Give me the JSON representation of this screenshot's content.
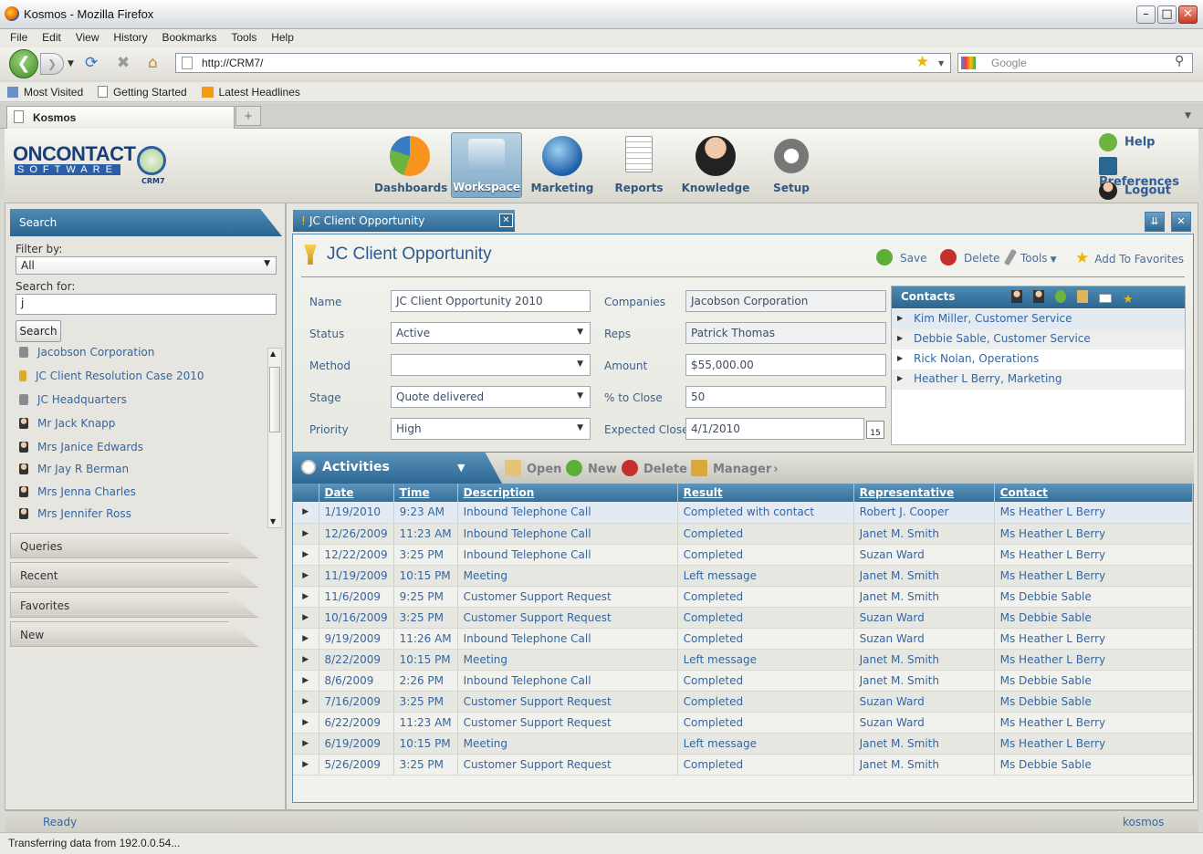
{
  "window": {
    "title": "Kosmos - Mozilla Firefox"
  },
  "menu": [
    "File",
    "Edit",
    "View",
    "History",
    "Bookmarks",
    "Tools",
    "Help"
  ],
  "nav": {
    "url": "http://CRM7/",
    "search_placeholder": "Google"
  },
  "bookmarks": [
    "Most Visited",
    "Getting Started",
    "Latest Headlines"
  ],
  "browser_tab": "Kosmos",
  "logo": {
    "line1": "ONCONTACT",
    "line2": "SOFTWARE",
    "badge": "CRM7"
  },
  "app_nav": [
    {
      "label": "Dashboards",
      "icon": "dashboards-icon"
    },
    {
      "label": "Workspace",
      "icon": "workspace-icon"
    },
    {
      "label": "Marketing",
      "icon": "marketing-icon"
    },
    {
      "label": "Reports",
      "icon": "reports-icon"
    },
    {
      "label": "Knowledge",
      "icon": "knowledge-icon"
    },
    {
      "label": "Setup",
      "icon": "setup-icon"
    }
  ],
  "header_links": {
    "help": "Help",
    "preferences": "Preferences",
    "logout": "Logout"
  },
  "sidebar": {
    "search_title": "Search",
    "filter_label": "Filter by:",
    "filter_value": "All",
    "search_for_label": "Search for:",
    "search_value": "j",
    "search_button": "Search",
    "results": [
      "Jacobson Corporation",
      "JC Client Resolution Case 2010",
      "JC Headquarters",
      "Mr Jack Knapp",
      "Mrs Janice Edwards",
      "Mr Jay R Berman",
      "Mrs Jenna Charles",
      "Mrs Jennifer Ross"
    ],
    "sections": [
      "Queries",
      "Recent",
      "Favorites",
      "New"
    ]
  },
  "doc_tab": "JC Client Opportunity",
  "form": {
    "title": "JC Client Opportunity",
    "actions": {
      "save": "Save",
      "delete": "Delete",
      "tools": "Tools",
      "favorites": "Add To Favorites"
    },
    "labels": {
      "name": "Name",
      "status": "Status",
      "method": "Method",
      "stage": "Stage",
      "priority": "Priority",
      "companies": "Companies",
      "reps": "Reps",
      "amount": "Amount",
      "pct": "% to Close",
      "close": "Expected Close"
    },
    "values": {
      "name": "JC Client Opportunity 2010",
      "status": "Active",
      "method": "",
      "stage": "Quote delivered",
      "priority": "High",
      "companies": "Jacobson Corporation",
      "reps": "Patrick Thomas",
      "amount": "$55,000.00",
      "pct": "50",
      "close": "4/1/2010"
    },
    "calendar_day": "15"
  },
  "contacts": {
    "title": "Contacts",
    "items": [
      "Kim Miller, Customer Service",
      "Debbie Sable, Customer Service",
      "Rick Nolan, Operations",
      "Heather L Berry, Marketing"
    ]
  },
  "activities": {
    "title": "Activities",
    "toolbar": {
      "open": "Open",
      "new": "New",
      "delete": "Delete",
      "manager": "Manager"
    },
    "columns": [
      "Date",
      "Time",
      "Description",
      "Result",
      "Representative",
      "Contact"
    ],
    "rows": [
      [
        "1/19/2010",
        "9:23 AM",
        "Inbound Telephone Call",
        "Completed with contact",
        "Robert J. Cooper",
        "Ms Heather L Berry"
      ],
      [
        "12/26/2009",
        "11:23 AM",
        "Inbound Telephone Call",
        "Completed",
        "Janet M. Smith",
        "Ms Heather L Berry"
      ],
      [
        "12/22/2009",
        "3:25 PM",
        "Inbound Telephone Call",
        "Completed",
        "Suzan Ward",
        "Ms Heather L Berry"
      ],
      [
        "11/19/2009",
        "10:15 PM",
        "Meeting",
        "Left message",
        "Janet M. Smith",
        "Ms Heather L Berry"
      ],
      [
        "11/6/2009",
        "9:25 PM",
        "Customer Support Request",
        "Completed",
        "Janet M. Smith",
        "Ms Debbie Sable"
      ],
      [
        "10/16/2009",
        "3:25 PM",
        "Customer Support Request",
        "Completed",
        "Suzan Ward",
        "Ms Debbie Sable"
      ],
      [
        "9/19/2009",
        "11:26 AM",
        "Inbound Telephone Call",
        "Completed",
        "Suzan Ward",
        "Ms Heather L Berry"
      ],
      [
        "8/22/2009",
        "10:15 PM",
        "Meeting",
        "Left message",
        "Janet M. Smith",
        "Ms Heather L Berry"
      ],
      [
        "8/6/2009",
        "2:26 PM",
        "Inbound Telephone Call",
        "Completed",
        "Janet M. Smith",
        "Ms Debbie Sable"
      ],
      [
        "7/16/2009",
        "3:25 PM",
        "Customer Support Request",
        "Completed",
        "Suzan Ward",
        "Ms Debbie Sable"
      ],
      [
        "6/22/2009",
        "11:23 AM",
        "Customer Support Request",
        "Completed",
        "Suzan Ward",
        "Ms Heather L Berry"
      ],
      [
        "6/19/2009",
        "10:15 PM",
        "Meeting",
        "Left message",
        "Janet M. Smith",
        "Ms Heather L Berry"
      ],
      [
        "5/26/2009",
        "3:25 PM",
        "Customer Support Request",
        "Completed",
        "Janet M. Smith",
        "Ms Debbie Sable"
      ]
    ]
  },
  "status": {
    "app": "Ready",
    "user": "kosmos",
    "browser": "Transferring data from 192.0.0.54..."
  },
  "colors": {
    "accent": "#2b6690",
    "link": "#3466a2"
  }
}
